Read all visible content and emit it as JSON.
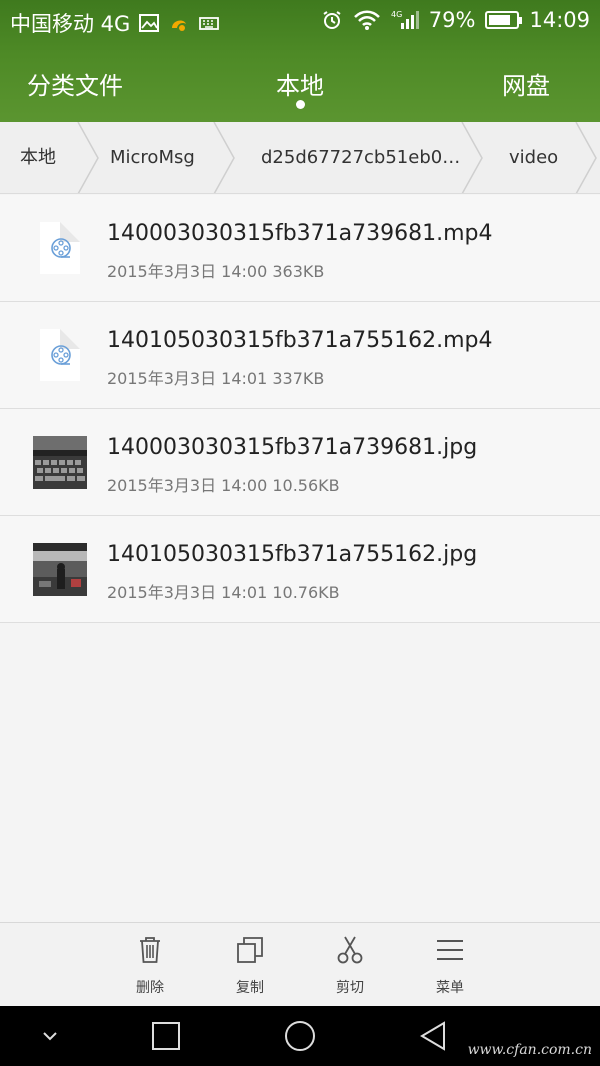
{
  "status_bar": {
    "carrier": "中国移动 4G",
    "network": "4G",
    "battery": "79%",
    "battery_level": 0.79,
    "time": "14:09",
    "icons": [
      "image-icon",
      "uc-browser-icon",
      "keyboard-icon",
      "alarm-icon",
      "wifi-icon",
      "signal-icon",
      "battery-icon"
    ]
  },
  "tabs": [
    {
      "label": "分类文件",
      "selected": false
    },
    {
      "label": "本地",
      "selected": true
    },
    {
      "label": "网盘",
      "selected": false
    }
  ],
  "breadcrumb": [
    {
      "label": "本地"
    },
    {
      "label": "MicroMsg"
    },
    {
      "label": "d25d67727cb51eb0…"
    },
    {
      "label": "video"
    }
  ],
  "files": [
    {
      "name": "140003030315fb371a739681.mp4",
      "meta": "2015年3月3日 14:00 363KB",
      "type": "video-icon"
    },
    {
      "name": "140105030315fb371a755162.mp4",
      "meta": "2015年3月3日 14:01 337KB",
      "type": "video-icon"
    },
    {
      "name": "140003030315fb371a739681.jpg",
      "meta": "2015年3月3日 14:00 10.56KB",
      "type": "photo-thumbnail"
    },
    {
      "name": "140105030315fb371a755162.jpg",
      "meta": "2015年3月3日 14:01 10.76KB",
      "type": "photo-thumbnail"
    }
  ],
  "actions": [
    {
      "label": "删除",
      "icon": "trash-icon"
    },
    {
      "label": "复制",
      "icon": "copy-icon"
    },
    {
      "label": "剪切",
      "icon": "scissors-icon"
    },
    {
      "label": "菜单",
      "icon": "menu-icon"
    }
  ],
  "navigation": {
    "icons": [
      "collapse-icon",
      "recent-apps-icon",
      "home-icon",
      "back-icon"
    ]
  },
  "watermark": "www.cfan.com.cn",
  "colors": {
    "header_green": "#4e8a26",
    "accent_blue": "#4a90e2"
  }
}
